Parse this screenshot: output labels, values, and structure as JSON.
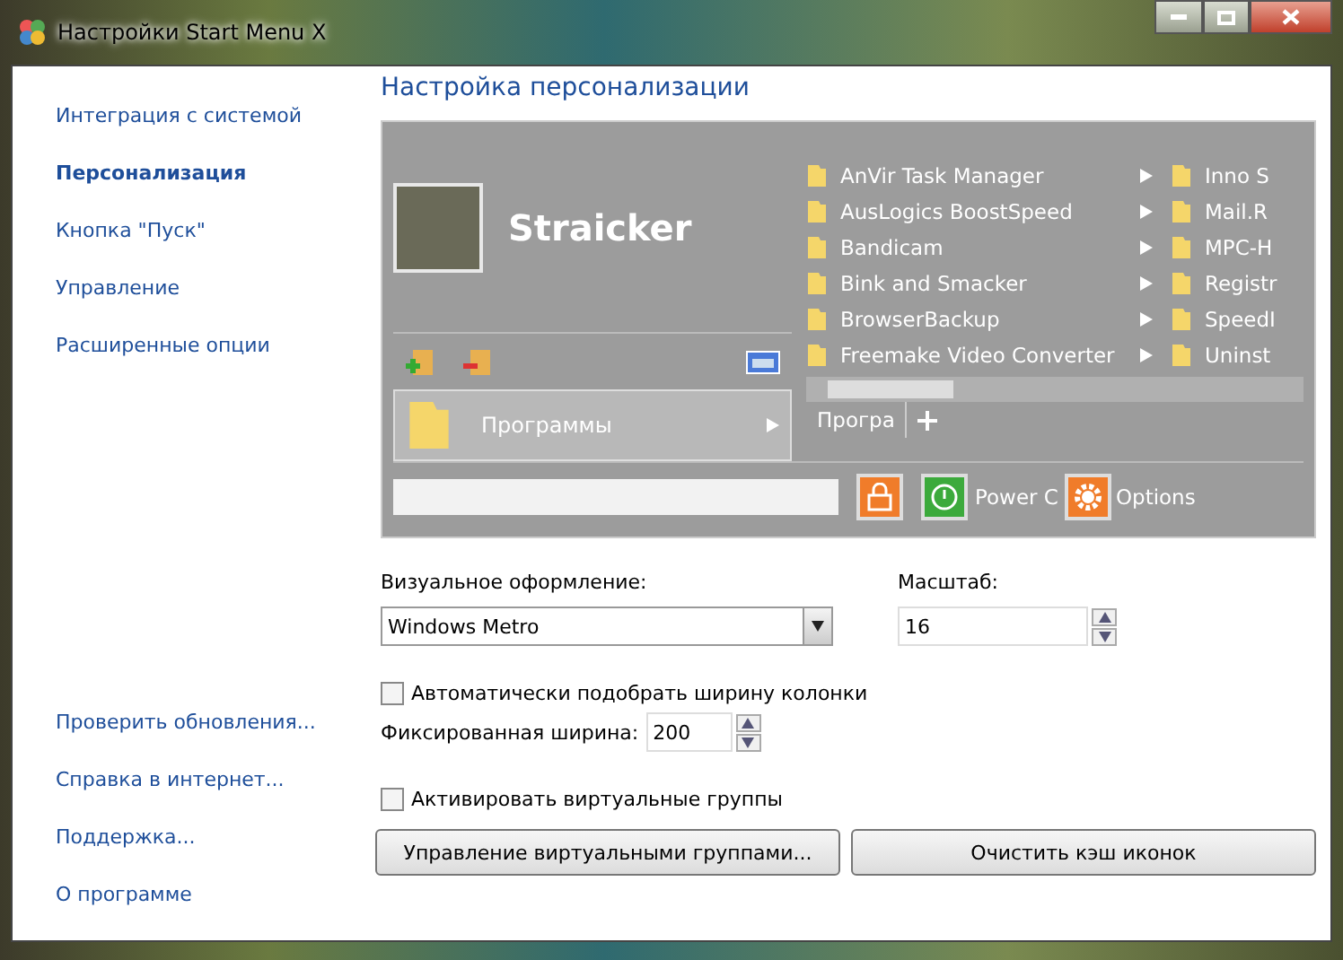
{
  "window": {
    "title": "Настройки Start Menu X"
  },
  "sidebar": {
    "items": [
      {
        "label": "Интеграция с системой",
        "selected": false
      },
      {
        "label": "Персонализация",
        "selected": true
      },
      {
        "label": "Кнопка \"Пуск\"",
        "selected": false
      },
      {
        "label": "Управление",
        "selected": false
      },
      {
        "label": "Расширенные опции",
        "selected": false
      }
    ],
    "links": [
      "Проверить обновления...",
      "Справка в интернет...",
      "Поддержка...",
      "О программе"
    ]
  },
  "heading": "Настройка персонализации",
  "preview": {
    "user_name": "Straicker",
    "programs_label": "Программы",
    "programs": [
      {
        "name": "AnVir Task Manager"
      },
      {
        "name": "AusLogics BoostSpeed"
      },
      {
        "name": "Bandicam"
      },
      {
        "name": "Bink and Smacker"
      },
      {
        "name": "BrowserBackup"
      },
      {
        "name": "Freemake Video Converter"
      }
    ],
    "column_2": [
      "Inno S",
      "Mail.R",
      "MPC-H",
      "Registr",
      "SpeedI",
      "Uninst"
    ],
    "tab": "Програ",
    "power_label": "Power C",
    "options_label": "Options"
  },
  "form": {
    "theme": {
      "label": "Визуальное оформление:",
      "value": "Windows Metro"
    },
    "scale": {
      "label": "Масштаб:",
      "value": "16"
    },
    "auto_width": {
      "label": "Автоматически подобрать ширину колонки",
      "checked": false
    },
    "fixed_width": {
      "label": "Фиксированная ширина:",
      "value": "200"
    },
    "virtual_groups": {
      "label": "Активировать виртуальные группы",
      "checked": false
    },
    "buttons": [
      "Управление виртуальными группами...",
      "Очистить кэш иконок"
    ]
  }
}
